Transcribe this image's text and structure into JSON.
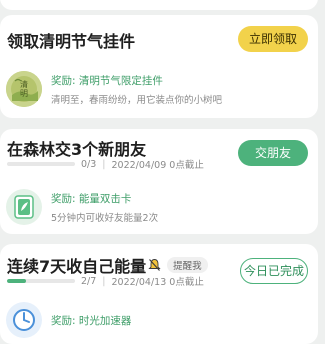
{
  "tasks": [
    {
      "title": "领取清明节气挂件",
      "button": "立即领取",
      "reward_title": "奖励: 清明节气限定挂件",
      "reward_desc": "清明至，春雨纷纷，用它装点你的小树吧",
      "reward_icon": "qingming-pendant-icon",
      "reward_icon_text": "清明"
    },
    {
      "title": "在森林交3个新朋友",
      "button": "交朋友",
      "progress": "0/3",
      "progress_value": 0,
      "progress_total": 3,
      "deadline": "2022/04/09 0点截止",
      "reward_title": "奖励: 能量双击卡",
      "reward_desc": "5分钟内可收好友能量2次",
      "reward_icon": "energy-double-card-icon"
    },
    {
      "title": "连续7天收自己能量",
      "tag": "提醒我",
      "button": "今日已完成",
      "progress": "2/7",
      "progress_value": 2,
      "progress_total": 7,
      "deadline": "2022/04/13 0点截止",
      "reward_title": "奖励: 时光加速器",
      "reward_icon": "time-accelerator-icon"
    }
  ],
  "colors": {
    "accent_green": "#4db27c",
    "accent_yellow": "#f2d24b",
    "background": "#eef0ef"
  }
}
